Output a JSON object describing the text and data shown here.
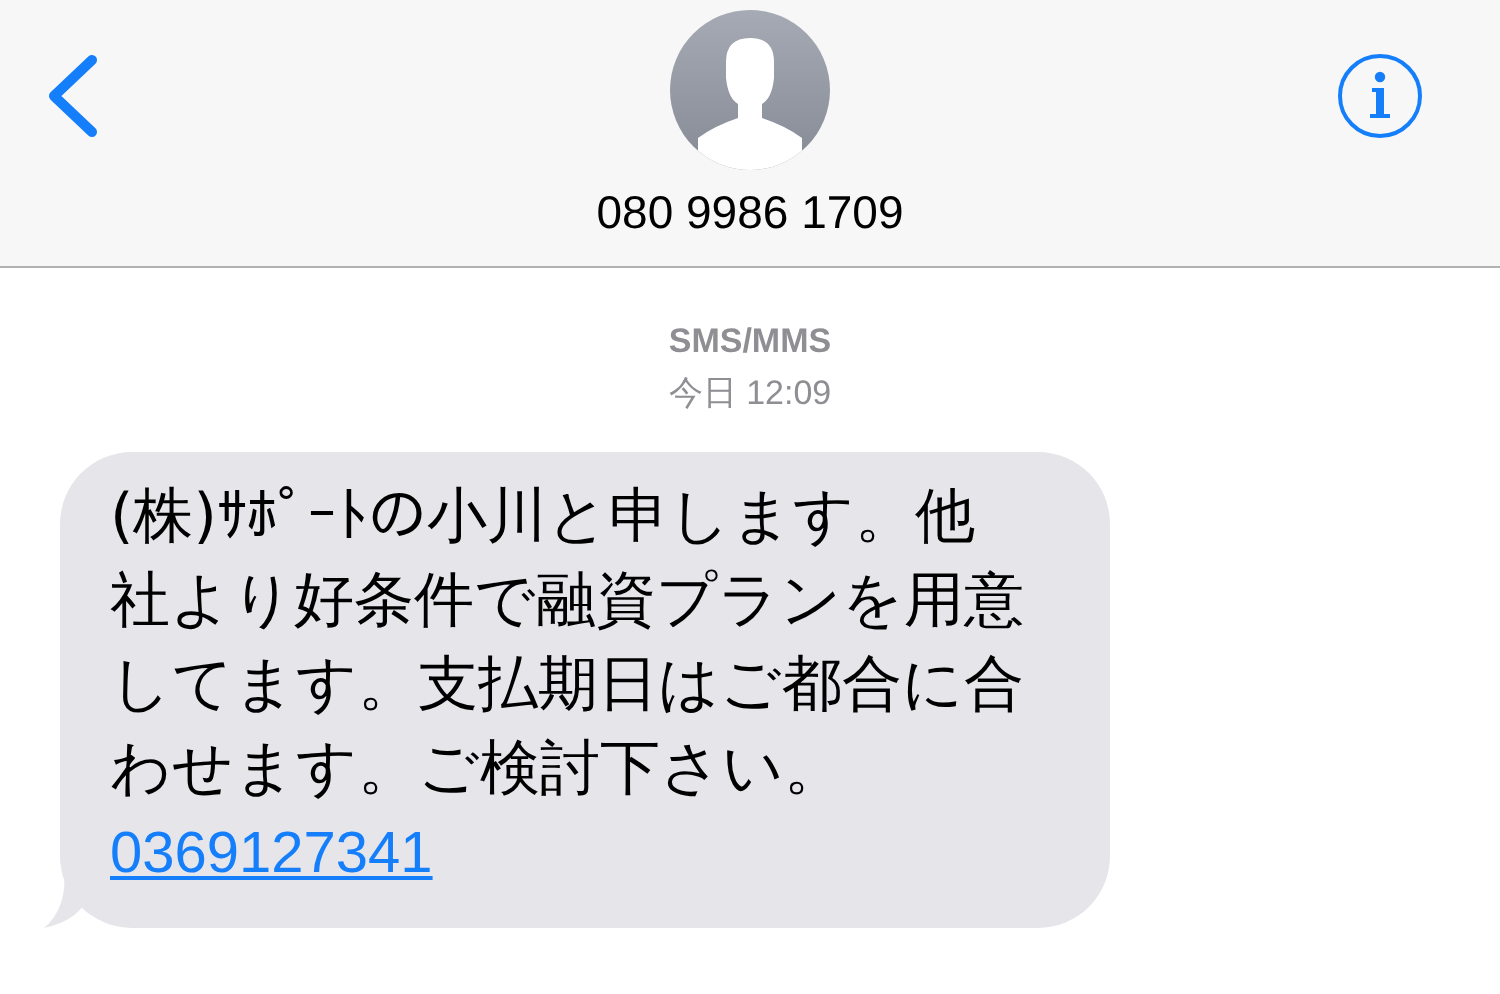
{
  "header": {
    "contact": "080 9986 1709"
  },
  "thread": {
    "service": "SMS/MMS",
    "timestamp": "今日 12:09"
  },
  "messages": [
    {
      "kind": "incoming",
      "text": "(株)ｻﾎﾟｰﾄの小川と申します。他社より好条件で融資プランを用意してます。支払期日はご都合に合わせます。ご検討下さい。",
      "link": "0369127341"
    }
  ]
}
